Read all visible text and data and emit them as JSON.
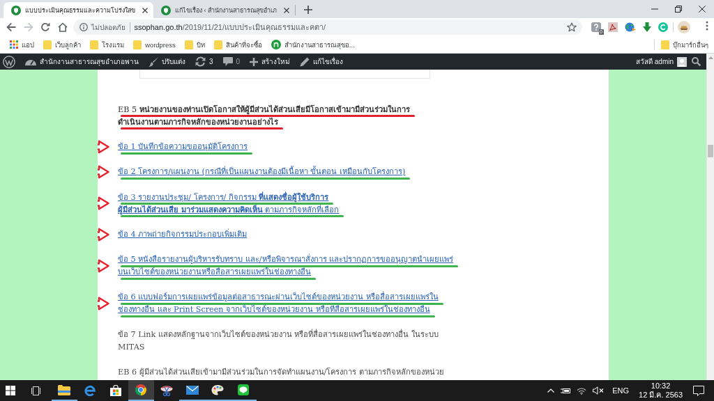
{
  "browser": {
    "tabs": [
      {
        "title": "แบบประเมินคุณธรรมและความโปร่งใสข",
        "selected": true
      },
      {
        "title": "แก้ไขเรื่อง ‹ สำนักงานสาธารณสุขอำเภ",
        "selected": false
      }
    ],
    "navigation": [
      {
        "kind": "back",
        "disabled": false
      },
      {
        "kind": "forward",
        "disabled": true
      },
      {
        "kind": "reload",
        "disabled": false
      },
      {
        "kind": "home",
        "disabled": false
      }
    ],
    "address_bar": {
      "security_label": "ไม่ปลอดภัย",
      "url_host": "ssophan.go.th",
      "url_path": "/2019/11/21/แบบประเมินคุณธรรมและคตา/"
    },
    "extension_badge": "0",
    "bookmarks": [
      {
        "kind": "apps",
        "label": "แอป"
      },
      {
        "kind": "folder",
        "label": "เว็บลูกค้า"
      },
      {
        "kind": "folder",
        "label": "โรงแรม"
      },
      {
        "kind": "folder",
        "label": "wordpress"
      },
      {
        "kind": "folder",
        "label": "บิท"
      },
      {
        "kind": "folder",
        "label": "สินค้าที่จะซื้อ"
      },
      {
        "kind": "site",
        "label": "สำนักงานสาธารณสุขอ..."
      }
    ],
    "other_bookmarks": "บุ๊กมาร์กอื่นๆ"
  },
  "admin_bar": {
    "items": [
      {
        "kind": "logo"
      },
      {
        "kind": "site",
        "label": "สำนักงานสาธารณสุขอำเภอพาน"
      },
      {
        "kind": "customize",
        "label": "ปรับแต่ง"
      },
      {
        "kind": "updates",
        "label": "3"
      },
      {
        "kind": "comments",
        "label": "0"
      },
      {
        "kind": "new",
        "label": "สร้างใหม่"
      },
      {
        "kind": "edit",
        "label": "แก้ไขเรื่อง"
      }
    ],
    "account": "สวัสดี admin"
  },
  "article": {
    "paragraphs": [
      {
        "kind": "heading",
        "lines": [
          "EB 5 **หน่วยงานของท่านเปิดโอกาสให้ผู้มีส่วนได้ส่วนเสียมีโอกาสเข้ามามีส่วนร่วมในการ**",
          "**ดำเนินงานตามภารกิจหลักของหน่วยงานอย่างไร**"
        ],
        "arrow": false,
        "underlined": true
      },
      {
        "kind": "link",
        "lines": [
          "ข้อ 1 บันทึกข้อความขออนุมัติโครงการ"
        ],
        "arrow": true,
        "underlined": true
      },
      {
        "kind": "link",
        "lines": [
          "ข้อ 2 โครงการ/แผนงาน (กรณีที่เป็นแผนงานต้องมีเนื้อหา ขั้นตอน เหมือนกับโครงการ)"
        ],
        "arrow": true,
        "underlined": true
      },
      {
        "kind": "link",
        "lines": [
          "ข้อ 3 รายงานประชุม/ โครงการ/ กิจกรรม **ที่แสดงชื่อผู้ใช้บริการ**",
          "**ผู้มีส่วนได้ส่วนเสีย มาร่วมแสดงความคิดเห็น** ตามภารกิจหลักที่เลือก"
        ],
        "arrow": true,
        "underlined": true
      },
      {
        "kind": "link",
        "lines": [
          "ข้อ 4 ภาพถ่ายกิจกรรมประกอบเพิ่มเติม"
        ],
        "arrow": true,
        "underlined": false
      },
      {
        "kind": "link",
        "lines": [
          "ข้อ 5 หนังสือรายงานผู้บริหารรับทราบ และ/หรือพิจารณาสั่งการ และปรากฏการขออนุญาตนำเผยแพร่",
          "บนเว็บไซต์ของหน่วยงานหรือสื่อสารเผยแพร่ในช่องทางอื่น"
        ],
        "arrow": true,
        "underlined": true
      },
      {
        "kind": "link",
        "lines": [
          "ข้อ 6 แบบฟอร์มการเผยแพร่ข้อมูลต่อสาธารณะผ่านเว็บไซต์ของหน่วยงาน หรือสื่อสารเผยแพร่ใน",
          "ช่องทางอื่น และ Print Screen จากเว็บไซต์ของหน่วยงาน หรือที่สื่อสารเผยแพร่ในช่องทางอื่น"
        ],
        "arrow": true,
        "underlined": true
      },
      {
        "kind": "text",
        "lines": [
          "ข้อ 7 Link แสดงหลักฐานจากเว็บไซต์ของหน่วยงาน หรือที่สื่อสารเผยแพร่ในช่องทางอื่น ในระบบ",
          "MITAS"
        ],
        "arrow": false,
        "underlined": false
      },
      {
        "kind": "text",
        "lines": [
          "EB 6 ผู้มีส่วนได้ส่วนเสียเข้ามามีส่วนร่วมในการจัดทำแผนงาน/โครงการ ตามภารกิจหลักของหน่วย"
        ],
        "arrow": false,
        "underlined": false
      }
    ]
  },
  "taskbar": {
    "apps": [
      {
        "kind": "start",
        "running": false,
        "selected": false
      },
      {
        "kind": "task_view",
        "running": false,
        "selected": false
      },
      {
        "kind": "explorer",
        "running": true,
        "selected": false
      },
      {
        "kind": "edge",
        "running": false,
        "selected": false
      },
      {
        "kind": "store",
        "running": false,
        "selected": false
      },
      {
        "kind": "chrome",
        "running": true,
        "selected": true
      },
      {
        "kind": "snip",
        "running": false,
        "selected": false
      },
      {
        "kind": "mail",
        "running": true,
        "selected": false
      },
      {
        "kind": "paint",
        "running": true,
        "selected": false
      },
      {
        "kind": "line",
        "running": true,
        "selected": false
      }
    ],
    "tray": {
      "volume_muted": true,
      "language": "ENG",
      "time": "10:32",
      "date": "12 มี.ค. 2563"
    }
  }
}
